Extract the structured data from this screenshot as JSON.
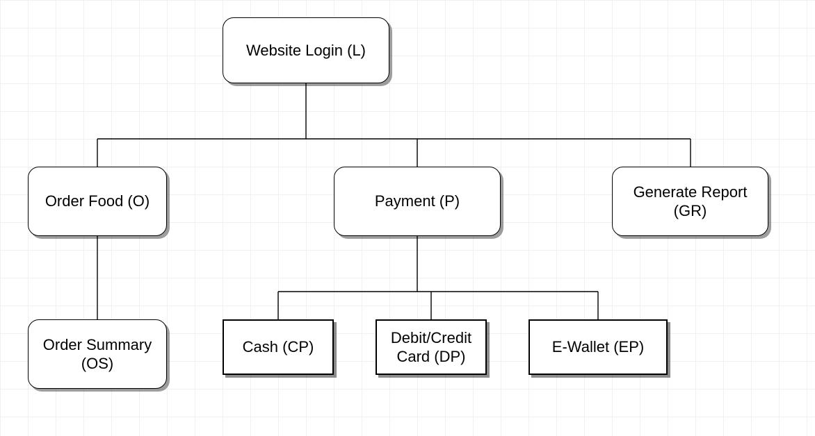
{
  "nodes": {
    "login": {
      "label": "Website Login (L)"
    },
    "order": {
      "label": "Order Food (O)"
    },
    "payment": {
      "label": "Payment (P)"
    },
    "report": {
      "label": "Generate Report\n(GR)"
    },
    "summary": {
      "label": "Order Summary\n(OS)"
    },
    "cash": {
      "label": "Cash (CP)"
    },
    "card": {
      "label": "Debit/Credit\nCard (DP)"
    },
    "ewallet": {
      "label": "E-Wallet (EP)"
    }
  },
  "hierarchy": {
    "root": "login",
    "children": {
      "login": [
        "order",
        "payment",
        "report"
      ],
      "order": [
        "summary"
      ],
      "payment": [
        "cash",
        "card",
        "ewallet"
      ]
    }
  }
}
